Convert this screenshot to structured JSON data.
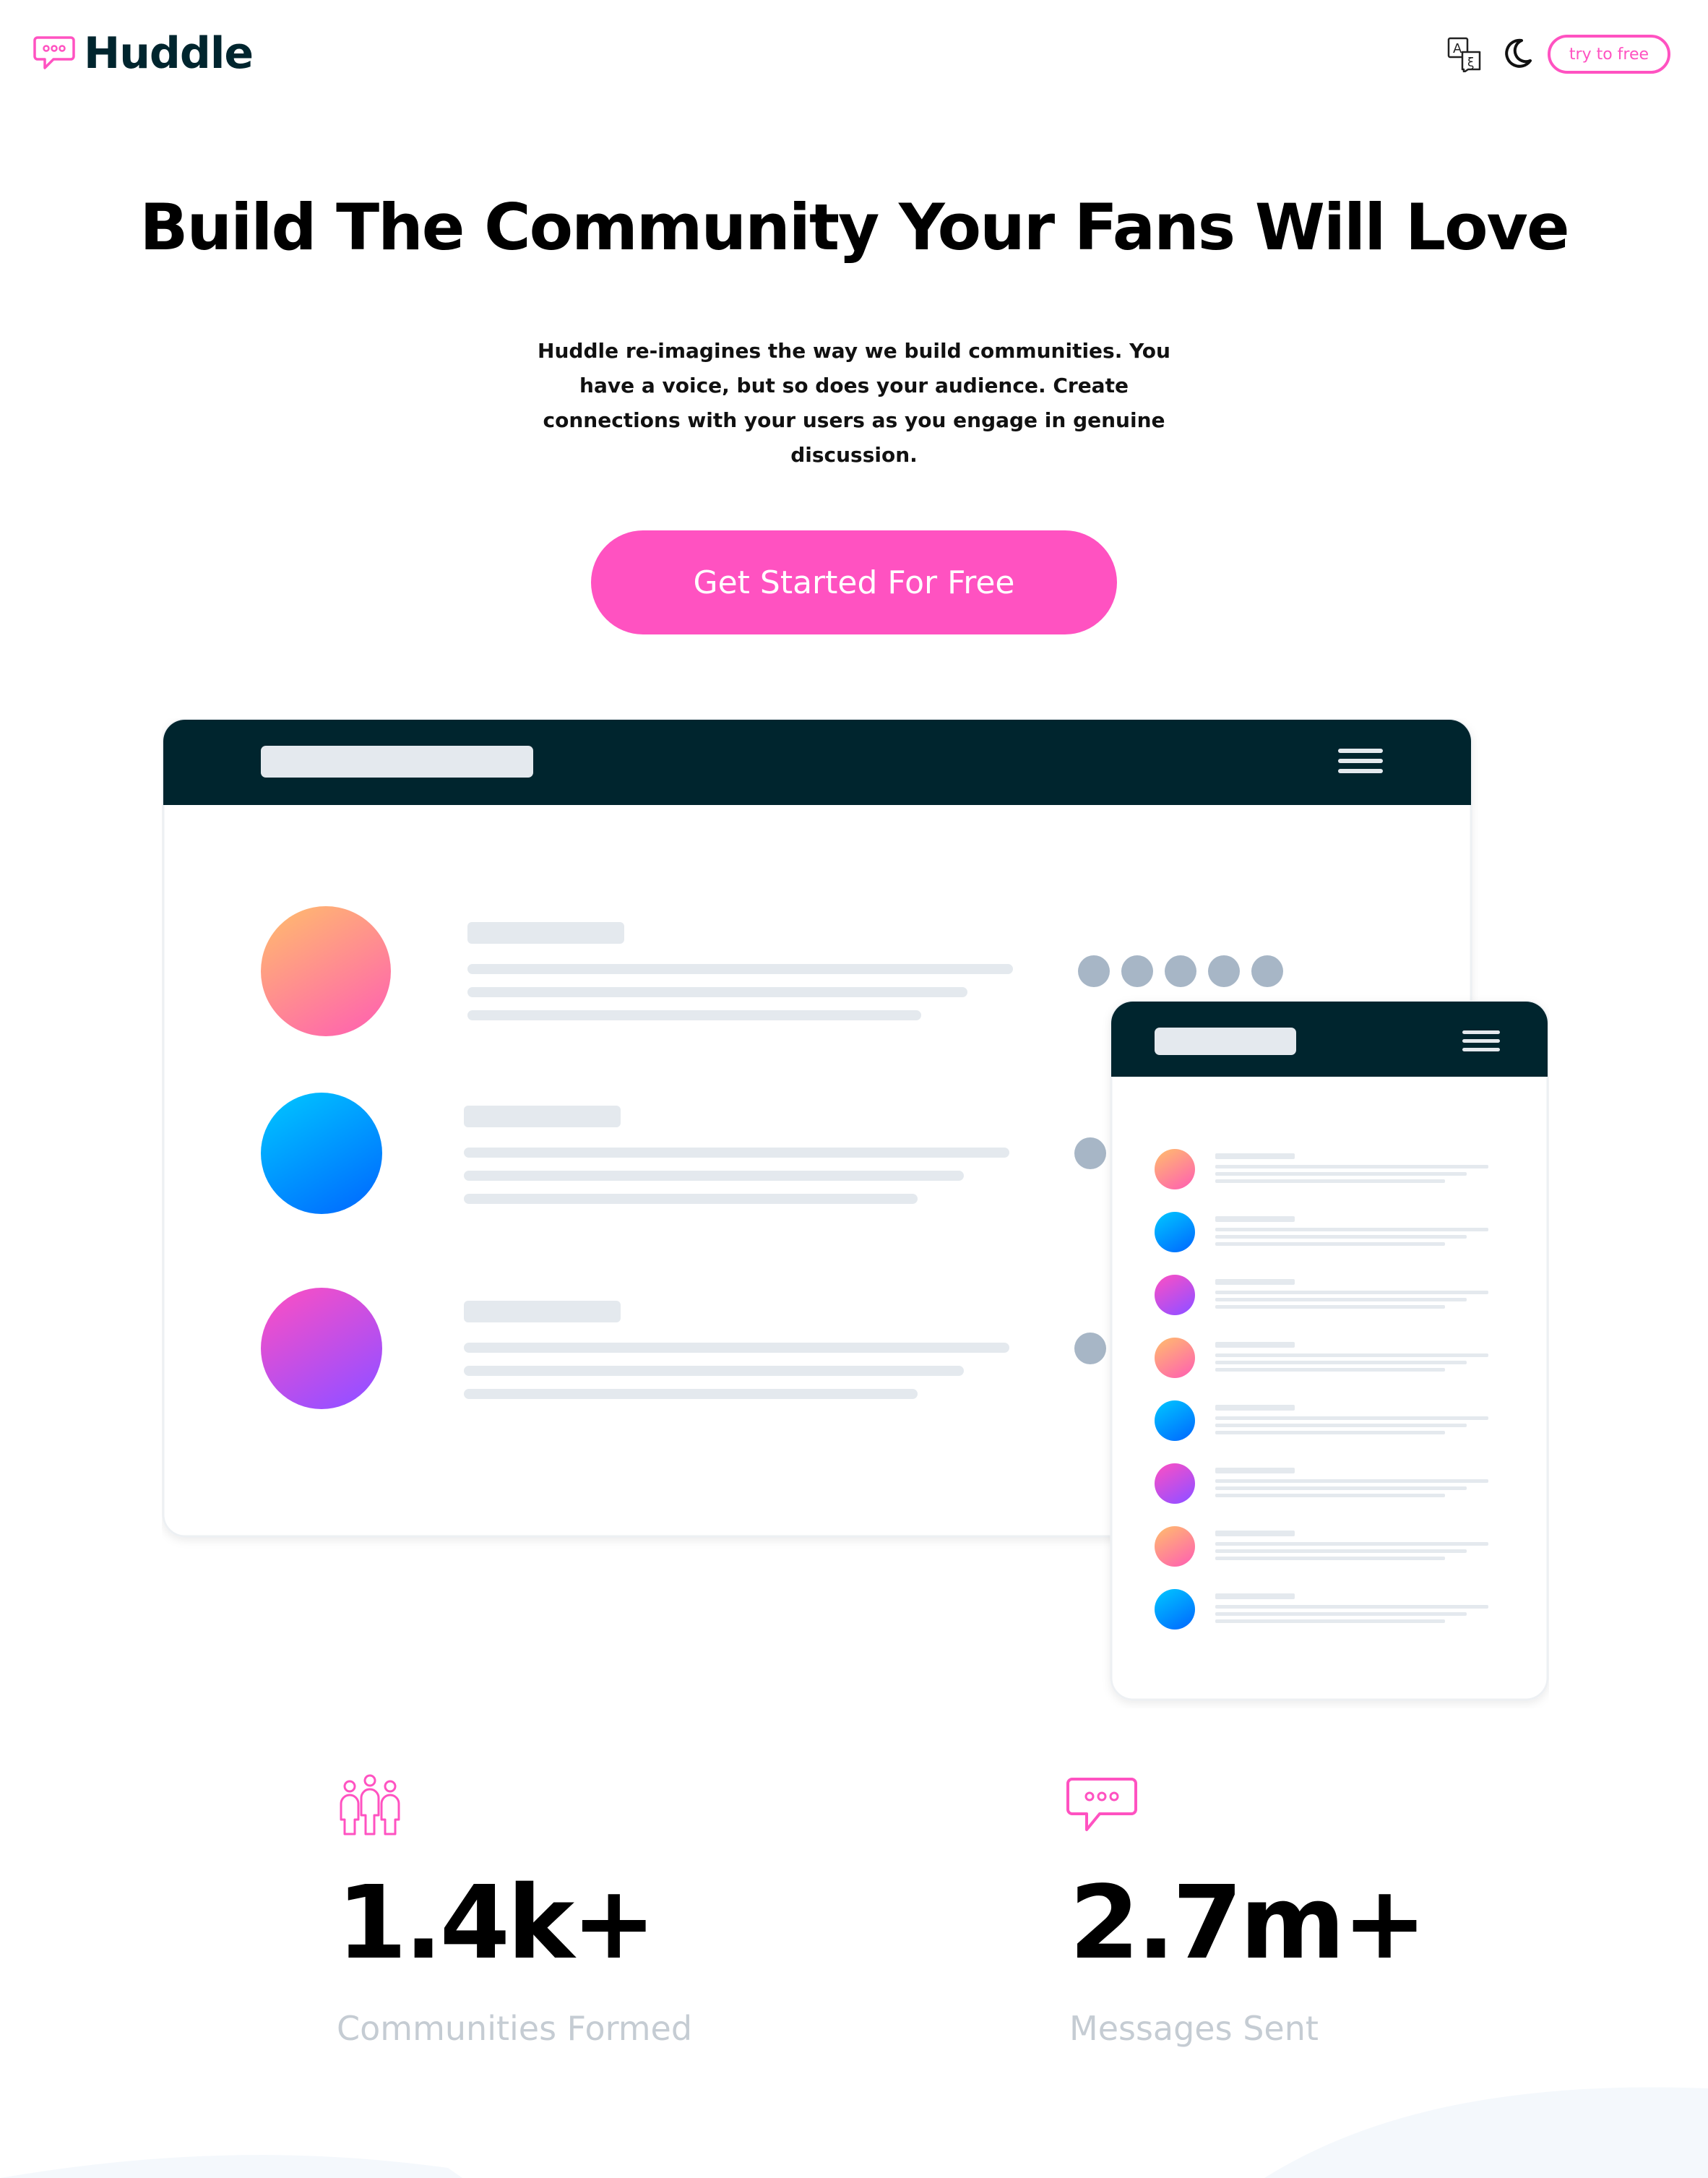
{
  "header": {
    "brand": "Huddle",
    "try_label": "try to free",
    "icons": [
      "chat-bubble-icon",
      "translate-icon",
      "moon-icon"
    ]
  },
  "hero": {
    "title": "Build The Community Your Fans Will Love",
    "description": "Huddle re-imagines the way we build communities. You have a voice, but so does your audience. Create connections with your users as you engage in genuine discussion.",
    "cta_label": "Get Started For Free"
  },
  "stats": [
    {
      "icon": "users-icon",
      "value": "1.4k+",
      "label": "Communities Formed"
    },
    {
      "icon": "chat-bubble-icon",
      "value": "2.7m+",
      "label": "Messages Sent"
    }
  ],
  "colors": {
    "brand_pink": "#ff52c1",
    "dark_navy": "#00252e",
    "muted_text": "#c5ccd3",
    "skeleton": "#e4e9ee",
    "dot": "#a7b6c6"
  }
}
